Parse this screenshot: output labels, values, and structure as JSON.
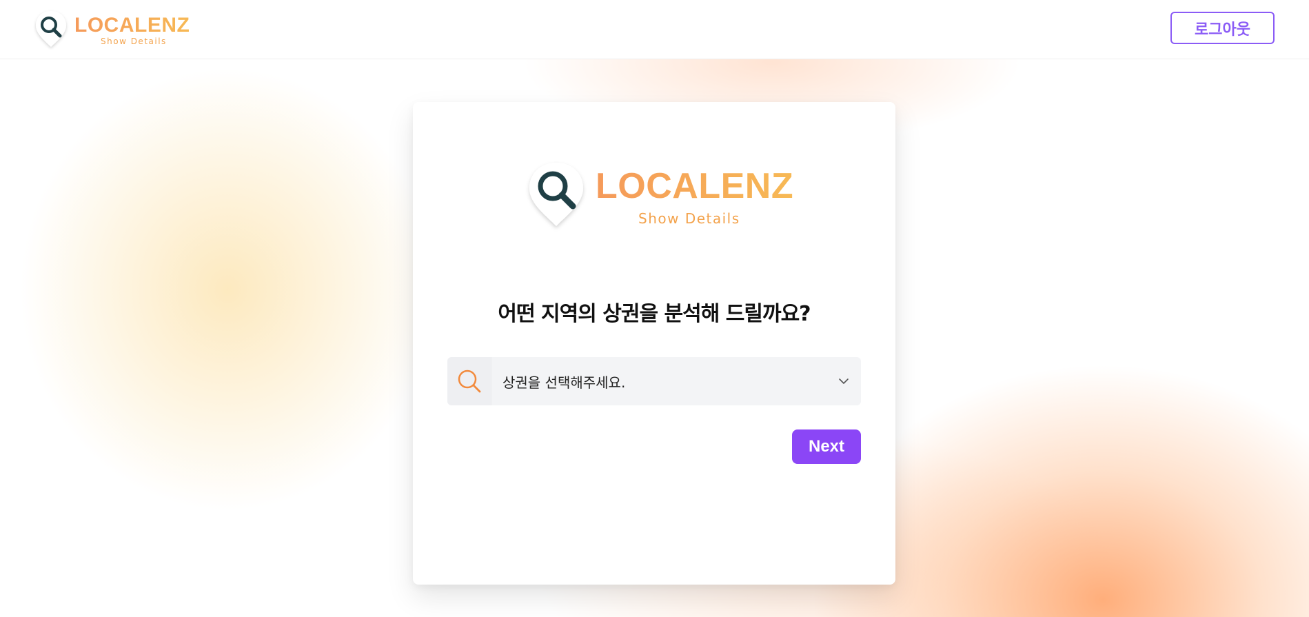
{
  "header": {
    "logo": {
      "name": "LOCALENZ",
      "tagline": "Show Details"
    },
    "logout_label": "로그아웃"
  },
  "card": {
    "logo": {
      "name": "LOCALENZ",
      "tagline": "Show Details"
    },
    "question": "어떤 지역의 상권을 분석해 드릴까요?",
    "select": {
      "value": "상권을 선택해주세요.",
      "icon": "search-icon",
      "dropdown_icon": "chevron-down-icon"
    },
    "next_label": "Next"
  },
  "colors": {
    "accent": "#8b46f6",
    "logo_orange": "#f59a5a",
    "logo_yellow": "#f7b955",
    "logo_dark": "#1f3f45"
  }
}
